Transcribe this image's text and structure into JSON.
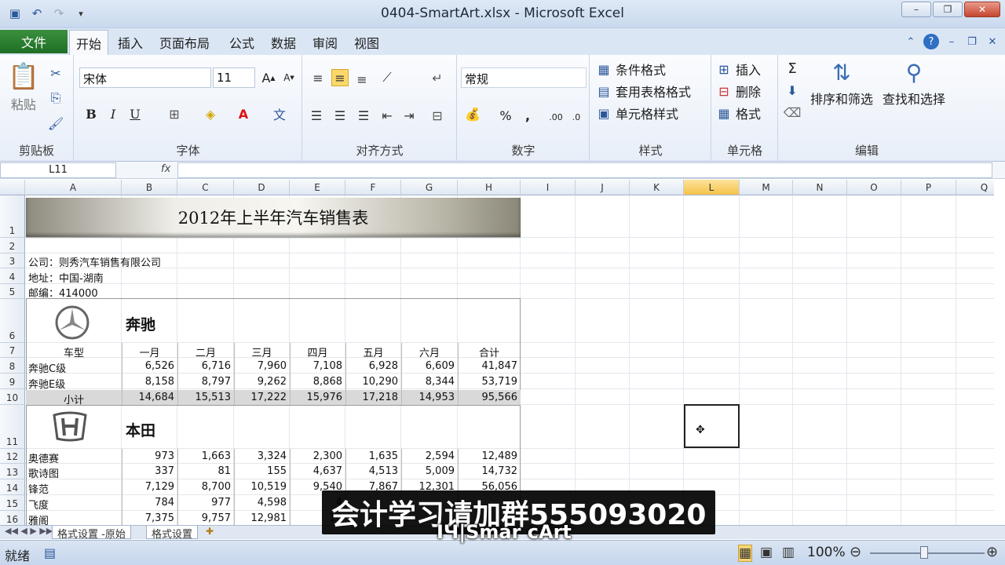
{
  "window": {
    "title": "0404-SmartArt.xlsx - Microsoft Excel"
  },
  "ribbon_tabs": [
    "文件",
    "开始",
    "插入",
    "页面布局",
    "公式",
    "数据",
    "审阅",
    "视图"
  ],
  "ribbon": {
    "clipboard": {
      "paste": "粘贴",
      "label": "剪贴板"
    },
    "font": {
      "name": "宋体",
      "size": "11",
      "label": "字体"
    },
    "alignment": {
      "label": "对齐方式"
    },
    "number": {
      "format": "常规",
      "label": "数字"
    },
    "styles": {
      "conditional": "条件格式",
      "table": "套用表格格式",
      "cell": "单元格样式",
      "label": "样式"
    },
    "cells": {
      "insert": "插入",
      "delete": "删除",
      "format": "格式",
      "label": "单元格"
    },
    "editing": {
      "sort": "排序和筛选",
      "find": "查找和选择",
      "label": "编辑"
    }
  },
  "formula_bar": {
    "name_box": "L11",
    "fx": "fx",
    "content": ""
  },
  "columns": [
    "A",
    "B",
    "C",
    "D",
    "E",
    "F",
    "G",
    "H",
    "I",
    "J",
    "K",
    "L",
    "M",
    "N",
    "O",
    "P",
    "Q"
  ],
  "rows": [
    "1",
    "2",
    "3",
    "4",
    "5",
    "6",
    "7",
    "8",
    "9",
    "10",
    "11",
    "12",
    "13",
    "14",
    "15",
    "16"
  ],
  "sheet": {
    "banner": "2012年上半年汽车销售表",
    "company": "公司：则秀汽车销售有限公司",
    "address": "地址：中国-湖南",
    "zip": "邮编：414000",
    "benz": {
      "brand": "奔驰",
      "headers": [
        "车型",
        "一月",
        "二月",
        "三月",
        "四月",
        "五月",
        "六月",
        "合计"
      ],
      "rows": [
        [
          "奔驰C级",
          "6,526",
          "6,716",
          "7,960",
          "7,108",
          "6,928",
          "6,609",
          "41,847"
        ],
        [
          "奔驰E级",
          "8,158",
          "8,797",
          "9,262",
          "8,868",
          "10,290",
          "8,344",
          "53,719"
        ],
        [
          "小计",
          "14,684",
          "15,513",
          "17,222",
          "15,976",
          "17,218",
          "14,953",
          "95,566"
        ]
      ]
    },
    "honda": {
      "brand": "本田",
      "rows": [
        [
          "奥德赛",
          "973",
          "1,663",
          "3,324",
          "2,300",
          "1,635",
          "2,594",
          "12,489"
        ],
        [
          "歌诗图",
          "337",
          "81",
          "155",
          "4,637",
          "4,513",
          "5,009",
          "14,732"
        ],
        [
          "锋范",
          "7,129",
          "8,700",
          "10,519",
          "9,540",
          "7,867",
          "12,301",
          "56,056"
        ],
        [
          "飞度",
          "784",
          "977",
          "4,598",
          "4",
          "",
          "",
          ""
        ],
        [
          "雅阁",
          "7,375",
          "9,757",
          "12,981",
          "10",
          "",
          "",
          ""
        ]
      ]
    }
  },
  "sheet_tabs": [
    "格式设置 -原始",
    "格式设置"
  ],
  "status": {
    "ready": "就绪",
    "zoom": "100%"
  },
  "overlay": {
    "subtitle": "会计学习请加群555093020",
    "caption": "IЧ|Smar cArt"
  }
}
